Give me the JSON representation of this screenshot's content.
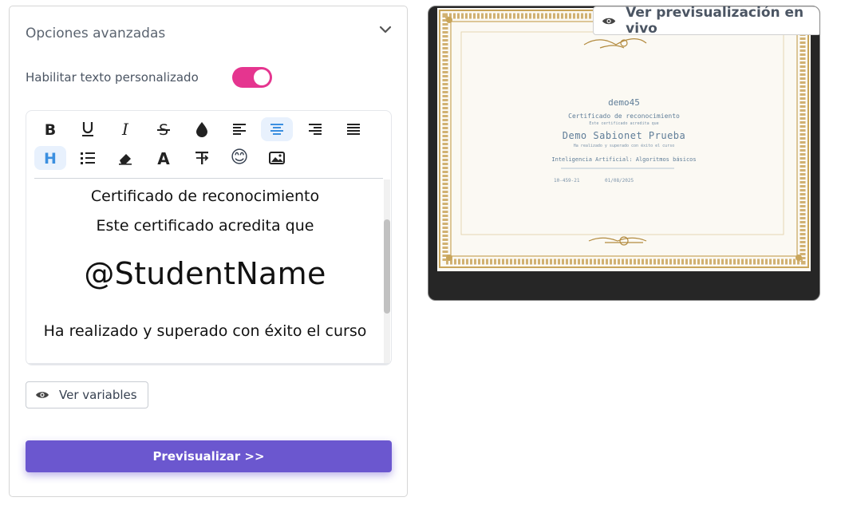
{
  "panel": {
    "title": "Opciones avanzadas",
    "toggle_label": "Habilitar texto personalizado",
    "toggle_on": true
  },
  "toolbar": {
    "icons": [
      "bold-icon",
      "underline-icon",
      "italic-icon",
      "strikethrough-icon",
      "color-drop-icon",
      "align-left-icon",
      "align-center-icon",
      "align-right-icon",
      "align-justify-icon",
      "heading-icon",
      "list-icon",
      "eraser-icon",
      "font-icon",
      "text-format-icon",
      "emoji-icon",
      "image-icon"
    ],
    "active": [
      "align-center-icon",
      "heading-icon"
    ],
    "emoji": "😊",
    "active_color": "#3b8fe0"
  },
  "editor": {
    "line1": "Certificado de reconocimiento",
    "line2": "Este certificado acredita que",
    "student_var": "@StudentName",
    "line4": "Ha realizado y superado con éxito el curso"
  },
  "buttons": {
    "variables": "Ver variables",
    "preview": "Previsualizar >>",
    "live_preview": "Ver previsualización en vivo"
  },
  "certificate": {
    "org": "demo45",
    "title": "Certificado de reconocimiento",
    "subtitle": "Este certificado acredita que",
    "student": "Demo Sabionet Prueba",
    "line": "Ha realizado y superado con éxito el curso",
    "course": "Inteligencia Artificial: Algoritmos básicos",
    "code": "10-459-21",
    "date": "01/08/2025"
  },
  "colors": {
    "accent": "#6b57cf",
    "toggle": "#e5358f",
    "gold": "#c9a55a",
    "cert_text": "#5f7d98"
  }
}
